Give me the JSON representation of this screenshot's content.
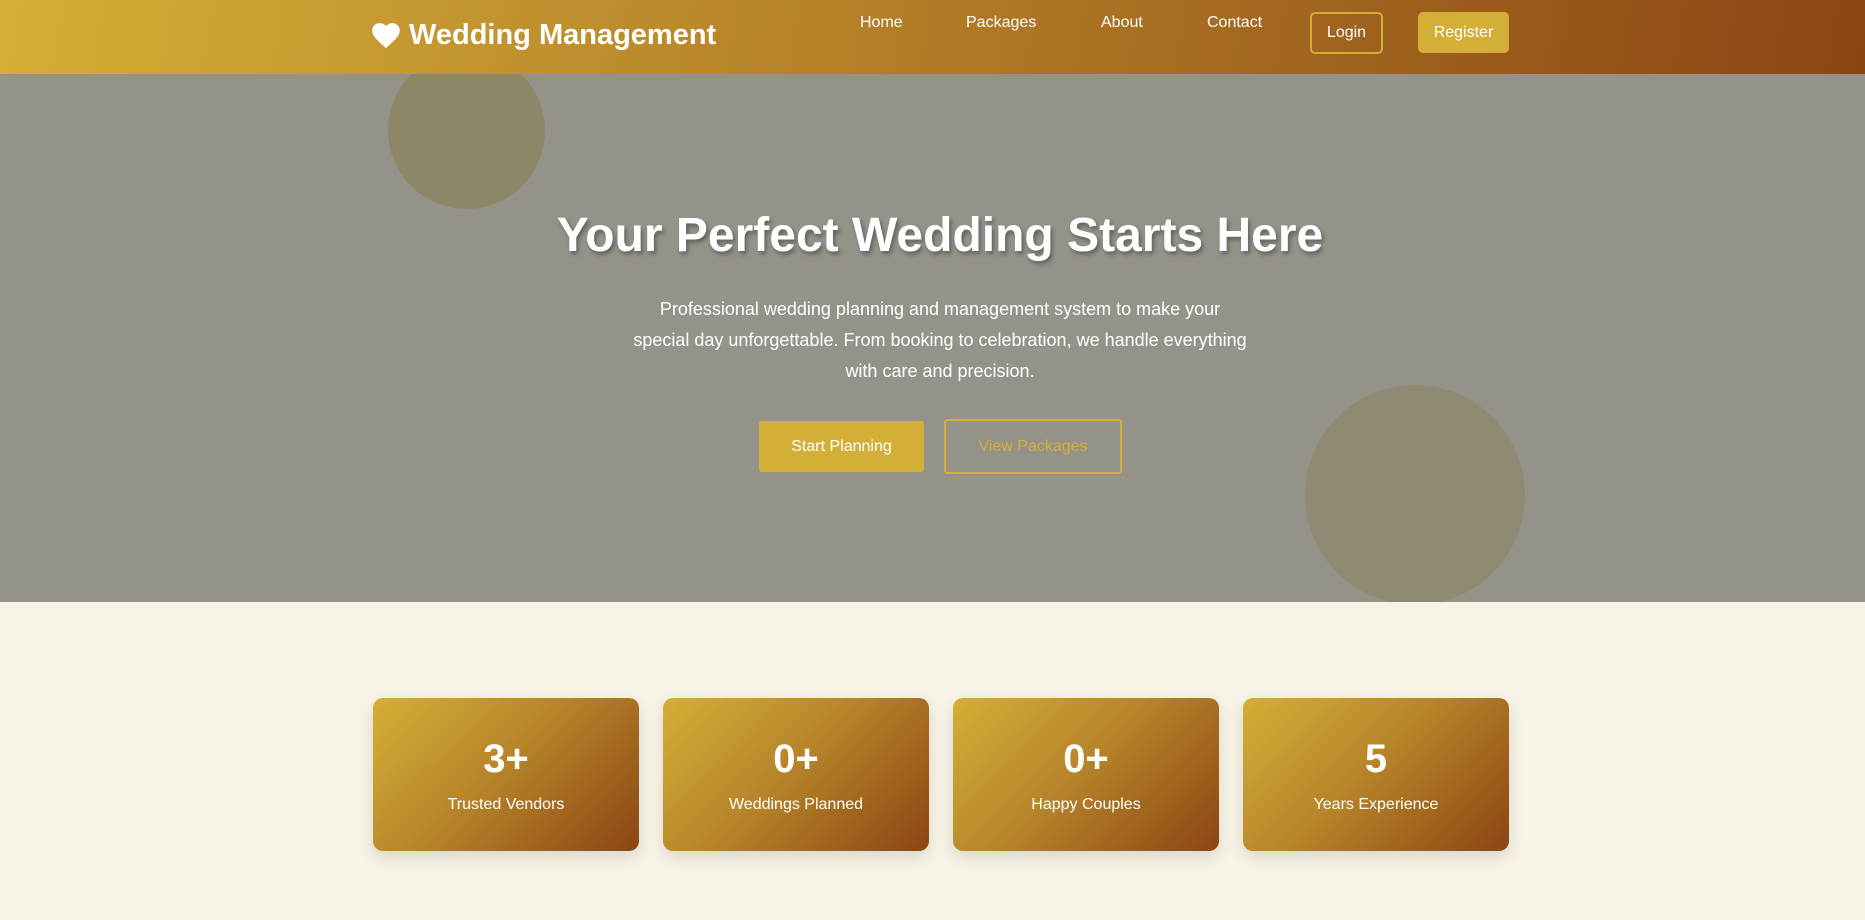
{
  "nav": {
    "brand": "Wedding Management",
    "links": [
      "Home",
      "Packages",
      "About",
      "Contact"
    ],
    "login": "Login",
    "register": "Register"
  },
  "hero": {
    "title": "Your Perfect Wedding Starts Here",
    "description": "Professional wedding planning and management system to make your special day unforgettable. From booking to celebration, we handle everything with care and precision.",
    "start_button": "Start Planning",
    "packages_button": "View Packages"
  },
  "stats": [
    {
      "number": "3+",
      "label": "Trusted Vendors"
    },
    {
      "number": "0+",
      "label": "Weddings Planned"
    },
    {
      "number": "0+",
      "label": "Happy Couples"
    },
    {
      "number": "5",
      "label": "Years Experience"
    }
  ],
  "colors": {
    "gold": "#d4af37",
    "brown": "#8b4513",
    "hero_overlay": "#95928a",
    "page_background": "#f7f3e6"
  },
  "icons": {
    "brand_icon": "heart-icon"
  }
}
